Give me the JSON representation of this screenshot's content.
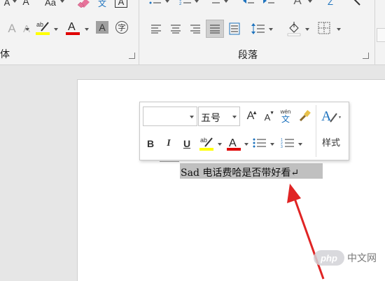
{
  "ribbon": {
    "font_group_label": "体",
    "paragraph_group_label": "段落",
    "change_case_label": "Aa",
    "grow_font_label": "A",
    "phonetic_label": "文",
    "char_border_label": "A",
    "encircle_label": "字",
    "highlight_color": "#ffff00",
    "font_color": "#e00000",
    "highlight_glyph": "ab",
    "font_color_glyph": "A",
    "font_clear_glyph": "A",
    "shade_glyph": "A",
    "sort_glyph": "Z",
    "text_effects_glyph": "A"
  },
  "mini_toolbar": {
    "font_name": "",
    "font_size": "五号",
    "grow_font": "A",
    "shrink_font": "A",
    "phonetic_top": "wén",
    "phonetic_bottom": "文",
    "bold": "B",
    "italic": "I",
    "underline": "U",
    "highlight_glyph": "ab",
    "font_color_glyph": "A",
    "styles_label": "样式",
    "styles_glyph": "A"
  },
  "document": {
    "selected_text": "Sad 电话费哈是否带好看↵"
  },
  "annotation": {
    "arrow_color": "#e02424"
  },
  "watermark": {
    "text": "php 中文网",
    "logo_text": "php",
    "site_text": "中文网"
  }
}
